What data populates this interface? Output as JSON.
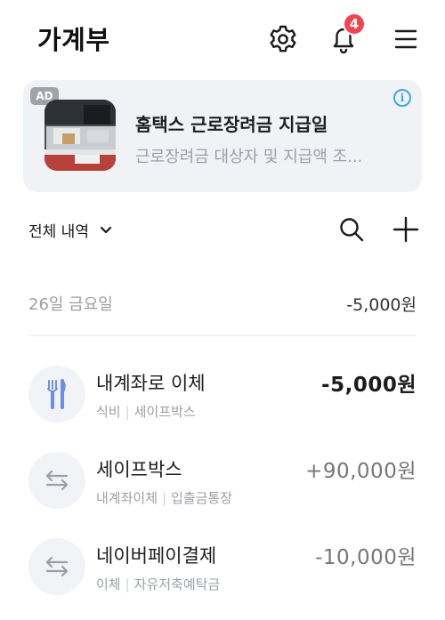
{
  "header": {
    "title": "가계부",
    "notification_count": "4",
    "icons": [
      "gear-icon",
      "bell-icon",
      "menu-icon"
    ]
  },
  "ad": {
    "tag": "AD",
    "info": "i",
    "title": "홈택스 근로장려금 지급일",
    "subtitle": "근로장려금 대상자 및 지급액 조..."
  },
  "toolbar": {
    "filter_label": "전체 내역",
    "icons": [
      "chevron-down-icon",
      "search-icon",
      "plus-icon"
    ]
  },
  "day_group": {
    "date_label": "26일 금요일",
    "total": "-5,000원"
  },
  "transactions": [
    {
      "name": "내계좌로 이체",
      "category": "식비",
      "account": "세이프박스",
      "amount": "-5,000원",
      "icon": "fork-knife-icon"
    },
    {
      "name": "세이프박스",
      "category": "내계좌이체",
      "account": "입출금통장",
      "amount": "+90,000원",
      "icon": "transfer-arrows-icon"
    },
    {
      "name": "네이버페이결제",
      "category": "이체",
      "account": "자유저축예탁금",
      "amount": "-10,000원",
      "icon": "transfer-arrows-icon"
    }
  ],
  "colors": {
    "badge": "#f04452",
    "info": "#3ca7e6",
    "muted_text": "#9aa0a6",
    "ad_background": "#f0f2f5",
    "icon_circle": "#f1f3f6",
    "fork_knife": "#6e8ee6"
  }
}
